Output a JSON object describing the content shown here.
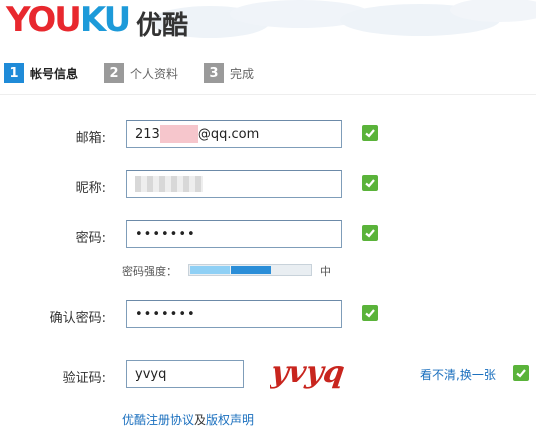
{
  "brand": {
    "logo_text": "YOUKU",
    "logo_cn": "优酷",
    "colors": {
      "logo_red": "#e8282e",
      "logo_blue": "#1d9ad9",
      "accent": "#1f8bd8",
      "check_green": "#5ab33a"
    }
  },
  "steps": [
    {
      "num": "1",
      "label": "帐号信息",
      "state": "active"
    },
    {
      "num": "2",
      "label": "个人资料",
      "state": "inactive"
    },
    {
      "num": "3",
      "label": "完成",
      "state": "inactive"
    }
  ],
  "form": {
    "email": {
      "label": "邮箱:",
      "value_prefix": "213",
      "value_suffix": "@qq.com",
      "valid": true
    },
    "nickname": {
      "label": "昵称:",
      "value": "",
      "valid": true
    },
    "password": {
      "label": "密码:",
      "value": "•••••••",
      "valid": true
    },
    "strength": {
      "label": "密码强度：",
      "level": "中",
      "fraction": 0.66
    },
    "confirm": {
      "label": "确认密码:",
      "value": "•••••••",
      "valid": true
    },
    "captcha": {
      "label": "验证码:",
      "value": "yvyq",
      "image_text": "yvyq",
      "refresh_label": "看不清,换一张",
      "valid": true
    }
  },
  "agreement": {
    "link1": "优酷注册协议",
    "and": "及",
    "link2": "版权声明"
  },
  "icons": {
    "check": "check-icon"
  }
}
